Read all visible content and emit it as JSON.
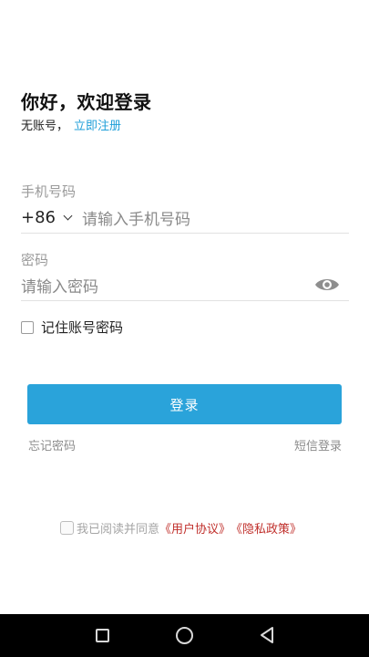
{
  "header": {
    "title": "你好，欢迎登录",
    "no_account_text": "无账号，",
    "register_link": "立即注册"
  },
  "phone_field": {
    "label": "手机号码",
    "country_code": "+86",
    "placeholder": "请输入手机号码"
  },
  "password_field": {
    "label": "密码",
    "placeholder": "请输入密码",
    "toggle_icon": "eye-icon"
  },
  "remember": {
    "label": "记住账号密码",
    "checked": false
  },
  "login_button": {
    "label": "登录",
    "color": "#2aa3da"
  },
  "links": {
    "forgot_password": "忘记密码",
    "sms_login": "短信登录"
  },
  "agreement": {
    "prefix": "我已阅读并同意",
    "user_agreement": "《用户协议》",
    "privacy_policy": "《隐私政策》",
    "checked": false,
    "link_color": "#c0302c"
  },
  "navbar": {
    "icons": [
      "recent-apps-icon",
      "home-icon",
      "back-icon"
    ]
  }
}
